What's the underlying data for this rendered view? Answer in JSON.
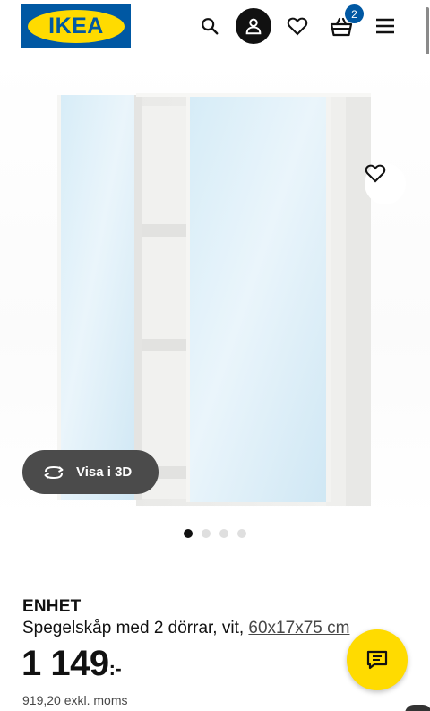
{
  "header": {
    "logo_text": "IKEA",
    "cart_count": "2"
  },
  "icons": {
    "search": "search-icon",
    "account": "person-icon",
    "favorites": "heart-icon",
    "cart": "basket-icon",
    "menu": "hamburger-menu-icon",
    "rotate": "rotate-3d-icon",
    "chat": "chat-icon"
  },
  "image": {
    "view_3d_label": "Visa i 3D",
    "carousel_total": 4,
    "carousel_active": 1
  },
  "product": {
    "name": "ENHET",
    "description": "Spegelskåp med 2 dörrar, vit,",
    "size": "60x17x75 cm",
    "price_main": "1 149",
    "price_suffix": ":-",
    "price_excl_vat": "919,20 exkl. moms"
  },
  "colors": {
    "ikea_blue": "#0058A3",
    "ikea_yellow": "#FFDB00",
    "pill_bg": "#4b4b4b"
  }
}
